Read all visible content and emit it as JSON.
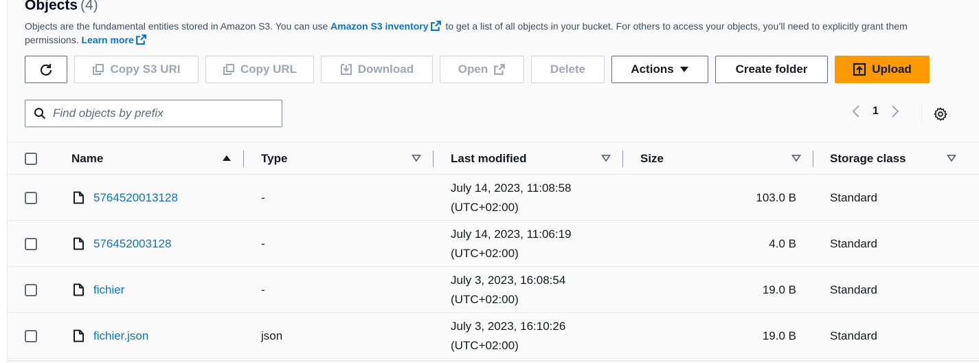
{
  "header": {
    "title": "Objects",
    "count": "(4)",
    "description_1": "Objects are the fundamental entities stored in Amazon S3. You can use",
    "inventory_link": "Amazon S3 inventory",
    "description_2": "to get a list of all objects in your bucket. For others to access your objects, you’ll need to explicitly grant them permissions.",
    "learn_more": "Learn more"
  },
  "toolbar": {
    "copy_s3_uri": "Copy S3 URI",
    "copy_url": "Copy URL",
    "download": "Download",
    "open": "Open",
    "delete": "Delete",
    "actions": "Actions",
    "create_folder": "Create folder",
    "upload": "Upload"
  },
  "search": {
    "placeholder": "Find objects by prefix",
    "value": ""
  },
  "pagination": {
    "current_page": "1"
  },
  "table": {
    "columns": {
      "name": "Name",
      "type": "Type",
      "last_modified": "Last modified",
      "size": "Size",
      "storage_class": "Storage class"
    },
    "rows": [
      {
        "name": "5764520013128",
        "type": "-",
        "date": "July 14, 2023, 11:08:58",
        "tz": "(UTC+02:00)",
        "size": "103.0 B",
        "storage_class": "Standard"
      },
      {
        "name": "576452003128",
        "type": "-",
        "date": "July 14, 2023, 11:06:19",
        "tz": "(UTC+02:00)",
        "size": "4.0 B",
        "storage_class": "Standard"
      },
      {
        "name": "fichier",
        "type": "-",
        "date": "July 3, 2023, 16:08:54",
        "tz": "(UTC+02:00)",
        "size": "19.0 B",
        "storage_class": "Standard"
      },
      {
        "name": "fichier.json",
        "type": "json",
        "date": "July 3, 2023, 16:10:26",
        "tz": "(UTC+02:00)",
        "size": "19.0 B",
        "storage_class": "Standard"
      }
    ]
  },
  "colors": {
    "accent": "#ff9900",
    "link": "#0972d3",
    "disabled": "#9ba7b6"
  }
}
